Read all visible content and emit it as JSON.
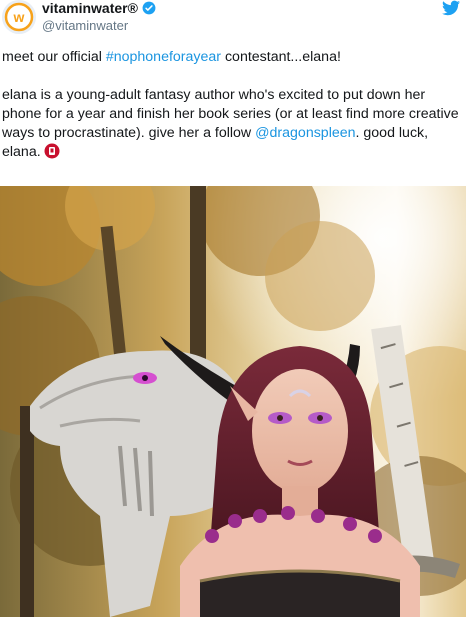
{
  "tweet": {
    "display_name": "vitaminwater®",
    "handle": "@vitaminwater",
    "line1_pre": "meet our official ",
    "line1_hashtag": "#nophoneforayear",
    "line1_post": " contestant...elana!",
    "body_pre": "elana is a young-adult fantasy author who's excited to put down her phone for a year and finish her book series (or at least find more creative ways to procrastinate). give her a follow ",
    "body_mention": "@dragonspleen",
    "body_post": ". good luck, elana."
  },
  "icons": {
    "verified": "verified-badge-icon",
    "platform": "twitter-bird-icon",
    "emoji": "vitaminwater-emoji-icon"
  },
  "colors": {
    "link": "#1b95e0",
    "verified": "#1da1f2",
    "handle": "#657786",
    "brand_orange": "#f7a21b"
  },
  "photo": {
    "subject": "cosplayer with dragon and sword"
  }
}
